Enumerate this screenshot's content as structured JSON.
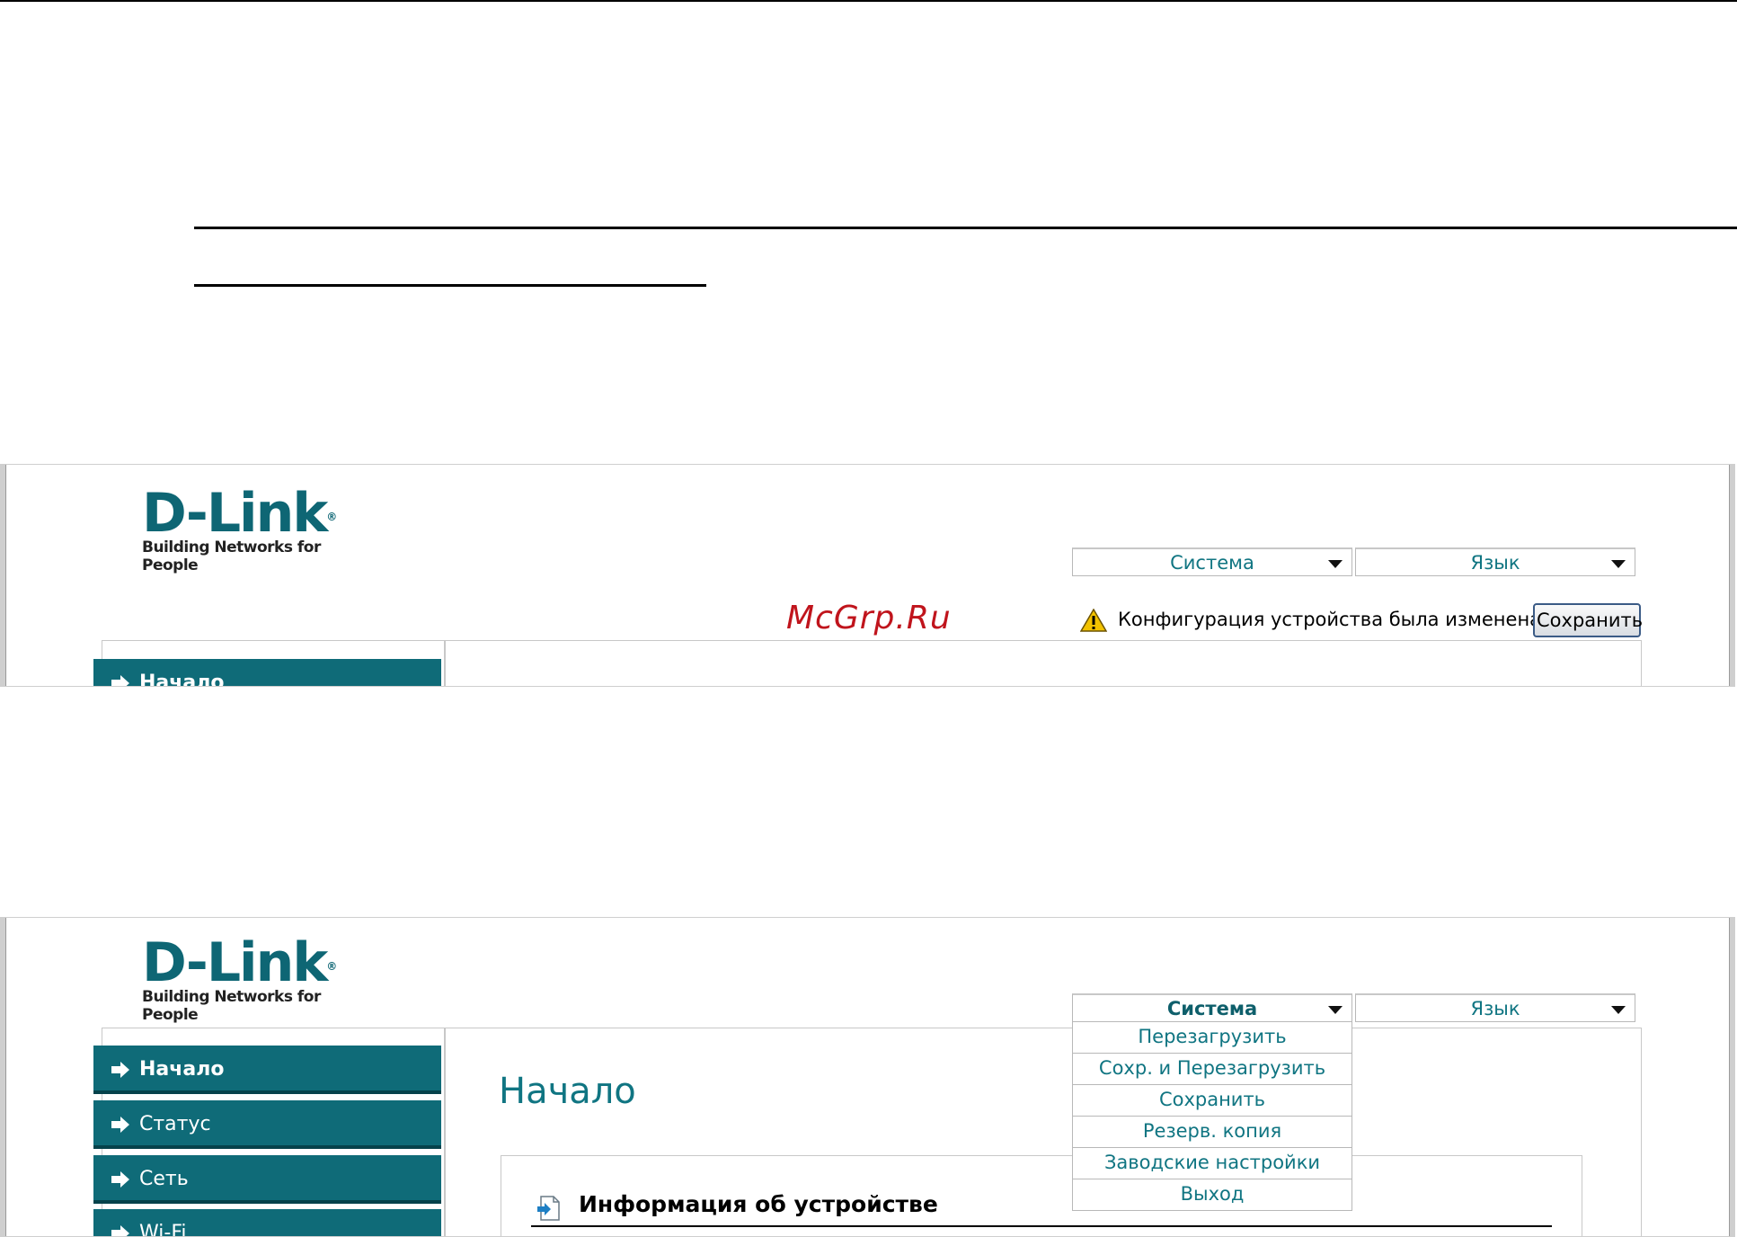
{
  "brand": {
    "logo_main": "D-Link",
    "logo_reg": "®",
    "tagline": "Building Networks for People"
  },
  "watermark": "McGrp.Ru",
  "header_menus": {
    "system_label": "Система",
    "language_label": "Язык"
  },
  "notice": {
    "message": "Конфигурация устройства была изменена",
    "save_button": "Сохранить"
  },
  "sidebar": {
    "items": [
      {
        "label": "Начало"
      },
      {
        "label": "Статус"
      },
      {
        "label": "Сеть"
      },
      {
        "label": "Wi-Fi"
      }
    ]
  },
  "system_menu": {
    "items": [
      {
        "label": "Перезагрузить"
      },
      {
        "label": "Сохр. и Перезагрузить"
      },
      {
        "label": "Сохранить"
      },
      {
        "label": "Резерв. копия"
      },
      {
        "label": "Заводские настройки"
      },
      {
        "label": "Выход"
      }
    ]
  },
  "main": {
    "page_title": "Начало",
    "panel_title": "Информация об устройстве"
  },
  "colors": {
    "brand_teal": "#0e6674",
    "nav_bg": "#0f6b78",
    "link_text": "#107582",
    "watermark_red": "#c0141c"
  }
}
